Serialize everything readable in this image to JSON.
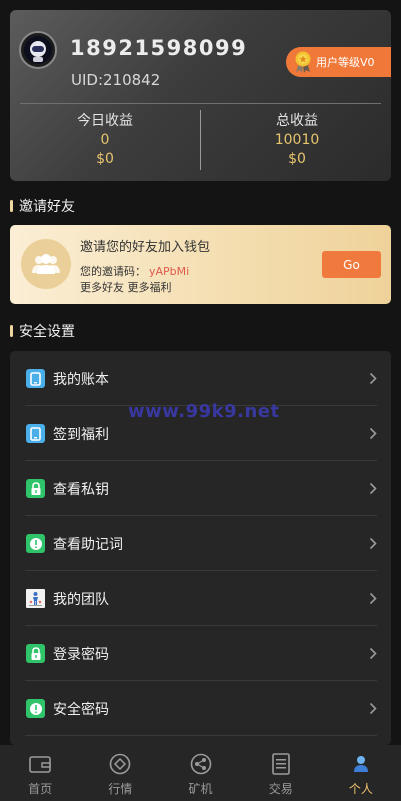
{
  "profile": {
    "phone": "18921598099",
    "uid": "UID:210842",
    "level_badge": "用户等级V0",
    "today": {
      "title": "今日收益",
      "value": "0",
      "usd": "$0"
    },
    "total": {
      "title": "总收益",
      "value": "10010",
      "usd": "$0"
    }
  },
  "invite_section": {
    "title": "邀请好友",
    "card_title": "邀请您的好友加入钱包",
    "code_label": "您的邀请码：",
    "code": "yAPbMi",
    "more": "更多好友 更多福利",
    "button": "Go"
  },
  "security_section": {
    "title": "安全设置",
    "items": [
      {
        "label": "我的账本",
        "icon": "ledger-icon"
      },
      {
        "label": "签到福利",
        "icon": "checkin-icon"
      },
      {
        "label": "查看私钥",
        "icon": "lock-icon"
      },
      {
        "label": "查看助记词",
        "icon": "info-icon"
      },
      {
        "label": "我的团队",
        "icon": "team-icon"
      },
      {
        "label": "登录密码",
        "icon": "lock-icon"
      },
      {
        "label": "安全密码",
        "icon": "info-icon"
      }
    ]
  },
  "watermark": "www.99k9.net",
  "nav": [
    {
      "label": "首页",
      "icon": "wallet-icon",
      "active": false
    },
    {
      "label": "行情",
      "icon": "market-icon",
      "active": false
    },
    {
      "label": "矿机",
      "icon": "miner-icon",
      "active": false
    },
    {
      "label": "交易",
      "icon": "trade-icon",
      "active": false
    },
    {
      "label": "个人",
      "icon": "person-icon",
      "active": true
    }
  ],
  "colors": {
    "accent": "#f07a3d",
    "gold": "#e7c56e",
    "active_nav": "#f0c36e",
    "blue_icon": "#4aaee8",
    "green_icon": "#2fc36a"
  }
}
